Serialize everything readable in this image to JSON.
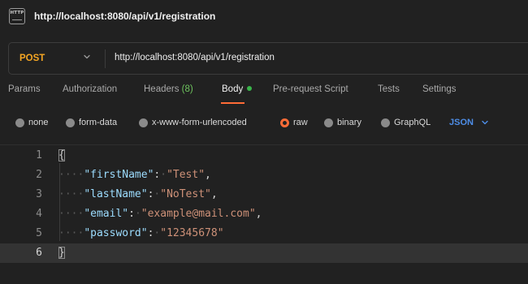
{
  "tab": {
    "icon": "http-file-icon",
    "icon_text": "HTTP",
    "title": "http://localhost:8080/api/v1/registration"
  },
  "request": {
    "method": "POST",
    "url": "http://localhost:8080/api/v1/registration",
    "method_color": "#f5a623"
  },
  "request_tabs": [
    {
      "label": "Params"
    },
    {
      "label": "Authorization"
    },
    {
      "label": "Headers",
      "count": "(8)"
    },
    {
      "label": "Body",
      "active": true
    },
    {
      "label": "Pre-request Script"
    },
    {
      "label": "Tests"
    },
    {
      "label": "Settings"
    }
  ],
  "body_types": [
    {
      "label": "none"
    },
    {
      "label": "form-data"
    },
    {
      "label": "x-www-form-urlencoded"
    },
    {
      "label": "raw",
      "selected": true
    },
    {
      "label": "binary"
    },
    {
      "label": "GraphQL"
    }
  ],
  "format": "JSON",
  "colors": {
    "accent": "#ff6c37",
    "active_dot": "#39b54a",
    "link_blue": "#4e8ee8",
    "json_key": "#9cdcfe",
    "json_string": "#ce9178"
  },
  "editor": {
    "lines": [
      {
        "number": "1"
      },
      {
        "number": "2",
        "key": "\"firstName\"",
        "value": "\"Test\""
      },
      {
        "number": "3",
        "key": "\"lastName\"",
        "value": "\"NoTest\""
      },
      {
        "number": "4",
        "key": "\"email\"",
        "value": "\"example@mail.com\""
      },
      {
        "number": "5",
        "key": "\"password\"",
        "value": "\"12345678\""
      },
      {
        "number": "6",
        "current": true
      }
    ],
    "open_brace": "{",
    "close_brace": "}",
    "colon": ":",
    "comma": ","
  }
}
